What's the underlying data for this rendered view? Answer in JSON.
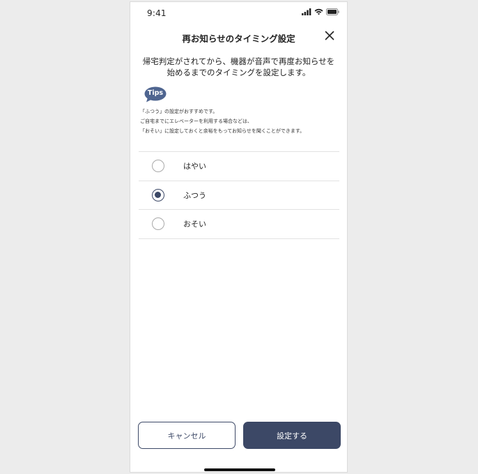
{
  "status_bar": {
    "time": "9:41",
    "icons": [
      "signal-icon",
      "wifi-icon",
      "battery-icon"
    ]
  },
  "header": {
    "title": "再お知らせのタイミング設定",
    "close_icon": "close-icon"
  },
  "description": {
    "line1": "帰宅判定がされてから、機器が音声で再度お知らせを",
    "line2": "始めるまでのタイミングを設定します。"
  },
  "tips": {
    "badge": "Tips",
    "lines": [
      "「ふつう」の設定がおすすめです。",
      "ご自宅までにエレベーターを利用する場合などは、",
      "「おそい」に設定しておくと余裕をもってお知らせを聞くことができます。"
    ]
  },
  "options": [
    {
      "label": "はやい",
      "selected": false
    },
    {
      "label": "ふつう",
      "selected": true
    },
    {
      "label": "おそい",
      "selected": false
    }
  ],
  "buttons": {
    "cancel": "キャンセル",
    "submit": "設定する"
  },
  "colors": {
    "accent": "#3c4866",
    "tips_badge": "#4f6590",
    "background": "#ececec"
  }
}
